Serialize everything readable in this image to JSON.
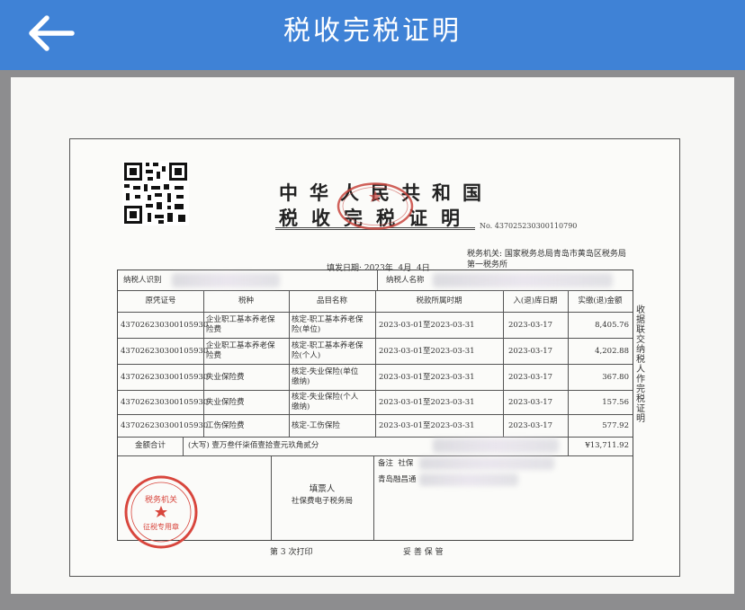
{
  "app": {
    "title": "税收完税证明",
    "back_icon": "arrow-left-icon"
  },
  "doc": {
    "title_line1": "中华人民共和国",
    "title_line2": "税收完税证明",
    "number": "No. 437025230300110790",
    "office_label": "税务机关:",
    "office_value": "国家税务总局青岛市黄岛区税务局第一税务所",
    "issue_date": "填发日期: 2023年  4月  4日",
    "taxpayer_id_label": "纳税人识别",
    "taxpayer_name_label": "纳税人名称",
    "headers": [
      "原凭证号",
      "税种",
      "品目名称",
      "税款所属时期",
      "入(退)库日期",
      "实缴(退)金额"
    ],
    "rows": [
      [
        "437026230300105930",
        "企业职工基本养老保\n险费",
        "核定-职工基本养老保\n险(单位)",
        "2023-03-01至2023-03-31",
        "2023-03-17",
        "8,405.76"
      ],
      [
        "437026230300105930",
        "企业职工基本养老保\n险费",
        "核定-职工基本养老保\n险(个人)",
        "2023-03-01至2023-03-31",
        "2023-03-17",
        "4,202.88"
      ],
      [
        "437026230300105930",
        "失业保险费",
        "核定-失业保险(单位\n缴纳)",
        "2023-03-01至2023-03-31",
        "2023-03-17",
        "367.80"
      ],
      [
        "437026230300105930",
        "失业保险费",
        "核定-失业保险(个人\n缴纳)",
        "2023-03-01至2023-03-31",
        "2023-03-17",
        "157.56"
      ],
      [
        "437026230300105930",
        "工伤保险费",
        "核定-工伤保险",
        "2023-03-01至2023-03-31",
        "2023-03-17",
        "577.92"
      ]
    ],
    "total_label": "金额合计",
    "total_words": "(大写) 壹万叁仟柒佰壹拾壹元玖角贰分",
    "total_value": "¥13,711.92",
    "seal_text": "税务机关",
    "seal_sub": "征税专用章",
    "filler_label": "填票人",
    "filler_value": "社保费电子税务局",
    "remark_label": "备注  社保",
    "remark_line2": "青岛融昌通",
    "side_note": "收据联交纳税人作完税证明",
    "footer_left": "第 3 次打印",
    "footer_right": "妥 善 保 管"
  }
}
